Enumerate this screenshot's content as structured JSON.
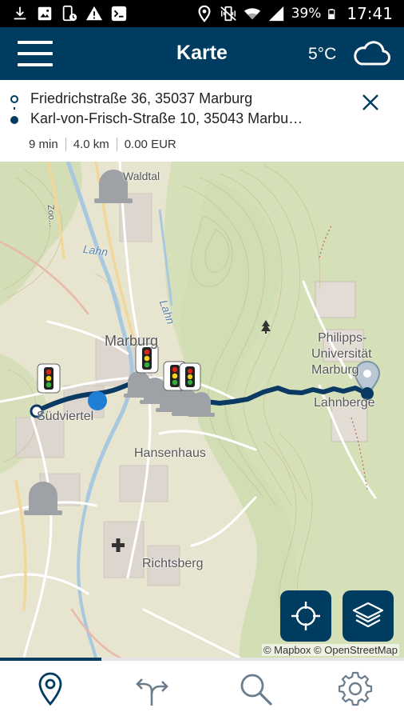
{
  "status_bar": {
    "left_icons": [
      "download-icon",
      "image-icon",
      "phone-update-icon",
      "warning-icon",
      "app-badge-icon"
    ],
    "right_icons": [
      "location-icon",
      "vibrate-icon",
      "wifi-icon",
      "signal-icon",
      "battery-icon"
    ],
    "battery_percent": "39%",
    "time": "17:41"
  },
  "header": {
    "title": "Karte",
    "temperature": "5°C",
    "weather_icon": "cloud-icon",
    "menu_icon": "hamburger-menu-icon"
  },
  "route": {
    "from_address": "Friedrichstraße 36, 35037 Marburg",
    "to_address": "Karl-von-Frisch-Straße 10, 35043 Marbu…",
    "duration": "9 min",
    "distance": "4.0 km",
    "cost": "0.00 EUR",
    "close_icon": "close-icon"
  },
  "map": {
    "place_labels": {
      "waldtal": "Waldtal",
      "lahn_1": "Lahn",
      "lahn_2": "Lahn",
      "marburg": "Marburg",
      "suedviertel": "Südviertel",
      "hansenhaus": "Hansenhaus",
      "richtsberg": "Richtsberg",
      "uni_1": "Philipps-",
      "uni_2": "Universität",
      "uni_3": "Marburg",
      "lahnberge": "Lahnberge",
      "zoo": "Zoo..."
    },
    "attribution": {
      "mapbox": "© Mapbox",
      "osm": "© OpenStreetMap"
    },
    "colors": {
      "route_line": "#0a3a63",
      "current_location": "#1f7fd6",
      "traffic_red": "#d8261c",
      "traffic_yellow": "#f6d21b",
      "traffic_green": "#2fae3c"
    },
    "icons": [
      "traffic-light-icon",
      "alert-flag-icon",
      "destination-pin-icon",
      "hospital-cross-icon",
      "tree-icon"
    ]
  },
  "map_controls": {
    "locate_icon": "crosshair-icon",
    "layers_icon": "layers-icon"
  },
  "progress": {
    "fraction": 0.25
  },
  "tabbar": {
    "tabs": [
      {
        "name": "map",
        "icon": "location-pin-icon",
        "active": true
      },
      {
        "name": "directions",
        "icon": "directions-icon",
        "active": false
      },
      {
        "name": "search",
        "icon": "search-icon",
        "active": false
      },
      {
        "name": "settings",
        "icon": "gear-icon",
        "active": false
      }
    ],
    "active_color": "#003b60",
    "inactive_color": "#6b7d8c"
  }
}
